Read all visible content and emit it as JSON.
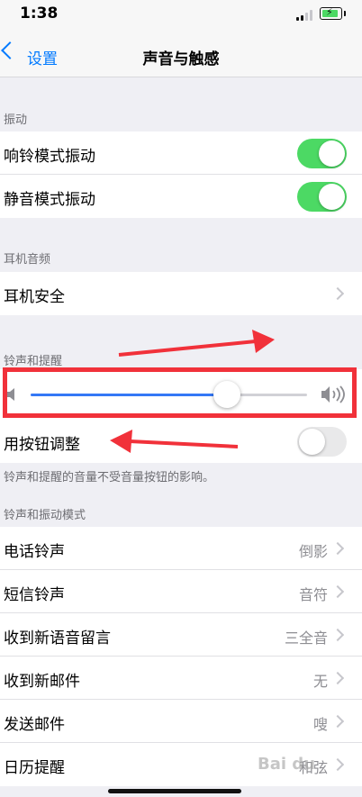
{
  "status_bar": {
    "time": "1:38"
  },
  "nav": {
    "back_label": "设置",
    "title": "声音与触感"
  },
  "sections": {
    "vibration": "振动",
    "headphone": "耳机音频",
    "ringer": "铃声和提醒",
    "sounds": "铃声和振动模式"
  },
  "vibration_rows": [
    {
      "label": "响铃模式振动",
      "on": true
    },
    {
      "label": "静音模式振动",
      "on": true
    }
  ],
  "headphone_rows": [
    {
      "label": "耳机安全"
    }
  ],
  "ringer": {
    "volume_level": 0.71,
    "button_adjust_label": "用按钮调整",
    "button_adjust_on": false,
    "footer_note": "铃声和提醒的音量不受音量按钮的影响。"
  },
  "sound_rows": [
    {
      "label": "电话铃声",
      "value": "倒影"
    },
    {
      "label": "短信铃声",
      "value": "音符"
    },
    {
      "label": "收到新语音留言",
      "value": "三全音"
    },
    {
      "label": "收到新邮件",
      "value": "无"
    },
    {
      "label": "发送邮件",
      "value": "嗖"
    },
    {
      "label": "日历提醒",
      "value": "和弦"
    }
  ],
  "watermark": "Bai du",
  "colors": {
    "accent": "#007aff",
    "toggle_on": "#4cd964",
    "slider_fill": "#3478f6",
    "annotation": "#f1313a"
  }
}
